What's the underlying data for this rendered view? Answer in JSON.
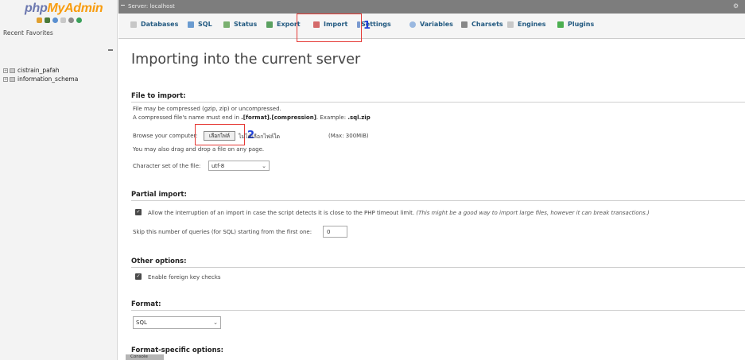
{
  "nav": {
    "logo_php": "php",
    "logo_my": "MyAdmin",
    "tab_recent": "Recent",
    "tab_favorites": "Favorites",
    "databases": [
      "cistrain_pafah",
      "information_schema"
    ]
  },
  "topbar": {
    "server": "Server: localhost"
  },
  "tabs": [
    {
      "label": "Databases",
      "icon": "database-icon"
    },
    {
      "label": "SQL",
      "icon": "sql-icon"
    },
    {
      "label": "Status",
      "icon": "status-icon"
    },
    {
      "label": "Export",
      "icon": "export-icon"
    },
    {
      "label": "Import",
      "icon": "import-icon"
    },
    {
      "label": "Settings",
      "icon": "settings-icon"
    },
    {
      "label": "Variables",
      "icon": "variables-icon"
    },
    {
      "label": "Charsets",
      "icon": "charsets-icon"
    },
    {
      "label": "Engines",
      "icon": "engines-icon"
    },
    {
      "label": "Plugins",
      "icon": "plugins-icon"
    }
  ],
  "annotations": {
    "one": "1",
    "two": "2"
  },
  "main": {
    "title": "Importing into the current server",
    "file_section": {
      "heading": "File to import:",
      "line1": "File may be compressed (gzip, zip) or uncompressed.",
      "line2_prefix": "A compressed file's name must end in ",
      "line2_format": ".[format].[compression]",
      "line2_mid": ". Example: ",
      "line2_example": ".sql.zip",
      "browse_label": "Browse your computer:",
      "choose_file_button": "เลือกไฟล์",
      "no_file_chosen": "ไม่ได้เลือกไฟล์ใด",
      "max_size": "(Max: 300MiB)",
      "drag_drop": "You may also drag and drop a file on any page.",
      "charset_label": "Character set of the file:",
      "charset_value": "utf-8"
    },
    "partial_section": {
      "heading": "Partial import:",
      "allow_interrupt": "Allow the interruption of an import in case the script detects it is close to the PHP timeout limit.",
      "allow_interrupt_note": "(This might be a good way to import large files, however it can break transactions.)",
      "skip_label": "Skip this number of queries (for SQL) starting from the first one:",
      "skip_value": "0"
    },
    "other_section": {
      "heading": "Other options:",
      "foreign_key": "Enable foreign key checks"
    },
    "format_section": {
      "heading": "Format:",
      "format_value": "SQL"
    },
    "format_specific_heading": "Format-specific options:",
    "console_label": "Console"
  },
  "colors": {
    "tab_text": "#235a81",
    "highlight": "#e53935",
    "annotation": "#1d3fd8"
  }
}
